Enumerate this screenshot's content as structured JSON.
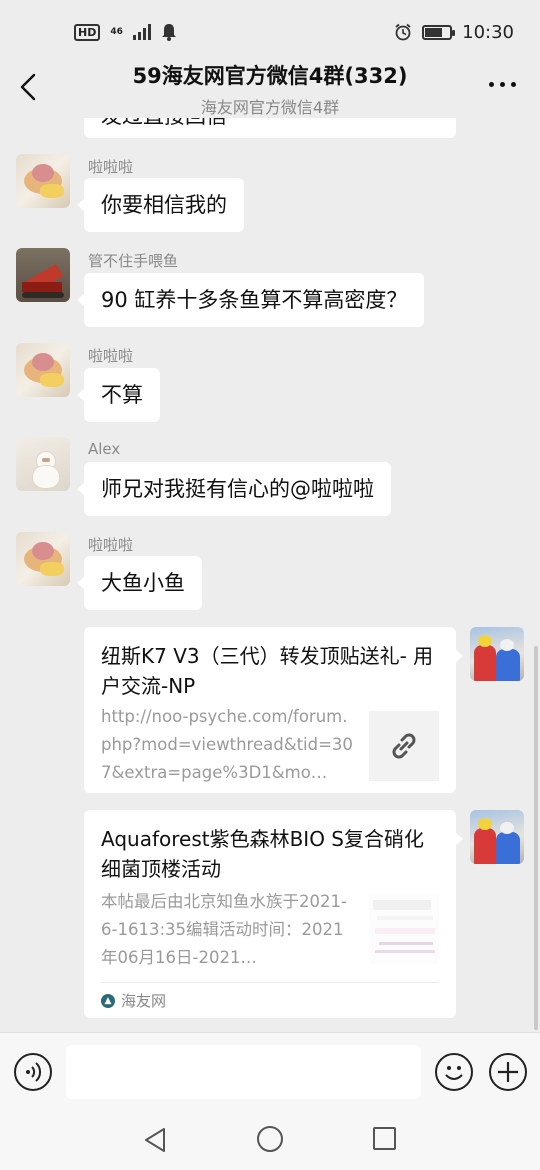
{
  "status_bar": {
    "hd": "HD",
    "network": "46",
    "time": "10:30"
  },
  "header": {
    "title": "59海友网官方微信4群(332)",
    "subtitle": "海友网官方微信4群"
  },
  "messages": [
    {
      "sender": "啦啦啦",
      "text": "你要相信我的",
      "avatar": "cake-avatar"
    },
    {
      "sender": "管不住手喂鱼",
      "text": "90 缸养十多条鱼算不算高密度？",
      "avatar": "crane-avatar"
    },
    {
      "sender": "啦啦啦",
      "text": "不算",
      "avatar": "cake-avatar"
    },
    {
      "sender": "Alex",
      "text": "师兄对我挺有信心的@啦啦啦",
      "avatar": "cat-avatar"
    },
    {
      "sender": "啦啦啦",
      "text": "大鱼小鱼",
      "avatar": "cake-avatar"
    }
  ],
  "cards": [
    {
      "title": "纽斯K7 V3（三代）转发顶贴送礼- 用户交流-NP",
      "desc": "http://noo-psyche.com/forum.php?mod=viewthread&tid=307&extra=page%3D1&mo…",
      "thumb_icon": "link-icon"
    },
    {
      "title": "Aquaforest紫色森林BIO S复合硝化细菌顶楼活动",
      "desc": "本帖最后由北京知鱼水族于2021-6-1613:35编辑活动时间：2021年06月16日-2021…",
      "source": "海友网"
    }
  ],
  "input": {
    "placeholder": ""
  }
}
